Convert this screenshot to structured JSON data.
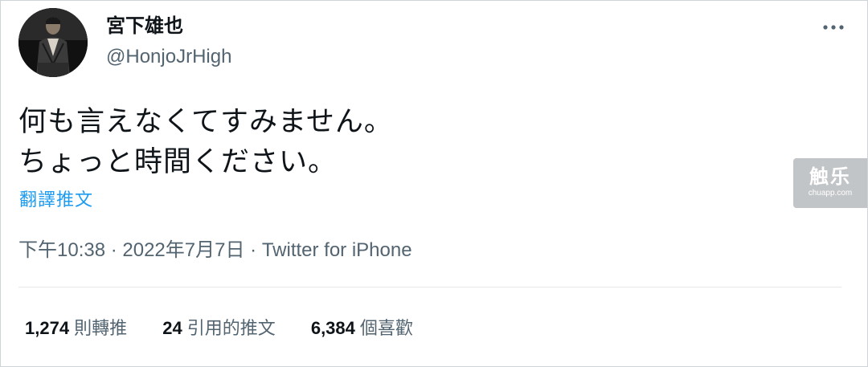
{
  "author": {
    "display_name": "宮下雄也",
    "handle": "@HonjoJrHigh",
    "avatar_icon": "avatar-photo"
  },
  "tweet": {
    "text": "何も言えなくてすみません。\nちょっと時間ください。",
    "translate_label": "翻譯推文"
  },
  "meta": {
    "time": "下午10:38",
    "separator": " · ",
    "date": "2022年7月7日",
    "source": "Twitter for iPhone"
  },
  "stats": [
    {
      "count": "1,274",
      "label": "則轉推"
    },
    {
      "count": "24",
      "label": "引用的推文"
    },
    {
      "count": "6,384",
      "label": "個喜歡"
    }
  ],
  "watermark": {
    "main": "触乐",
    "sub": "chuapp.com"
  },
  "colors": {
    "text_primary": "#0f1419",
    "text_secondary": "#536471",
    "link": "#1d9bf0",
    "divider": "#e6e9eb"
  }
}
